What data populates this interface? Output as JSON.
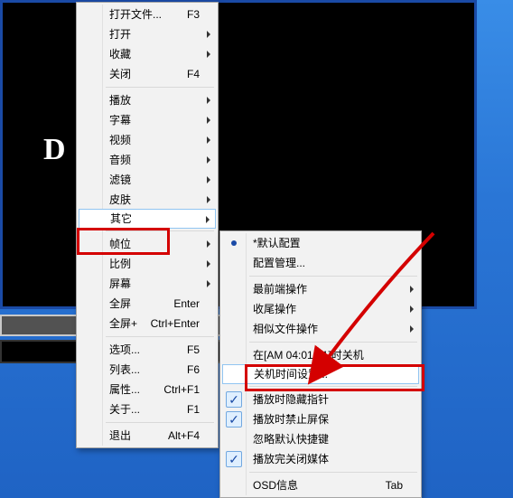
{
  "app_letter": "D",
  "menu1": {
    "openFile": {
      "label": "打开文件...",
      "kb": "F3"
    },
    "open": "打开",
    "fav": "收藏",
    "close": {
      "label": "关闭",
      "kb": "F4"
    },
    "play": "播放",
    "sub": "字幕",
    "video": "视频",
    "audio": "音频",
    "filter": "滤镜",
    "skin": "皮肤",
    "other": "其它",
    "fps": "帧位",
    "ratio": "比例",
    "screen": "屏幕",
    "fullscreen": {
      "label": "全屏",
      "kb": "Enter"
    },
    "fullscreenPlus": {
      "label": "全屏+",
      "kb": "Ctrl+Enter"
    },
    "options": {
      "label": "选项...",
      "kb": "F5"
    },
    "list": {
      "label": "列表...",
      "kb": "F6"
    },
    "props": {
      "label": "属性...",
      "kb": "Ctrl+F1"
    },
    "about": {
      "label": "关于...",
      "kb": "F1"
    },
    "exit": {
      "label": "退出",
      "kb": "Alt+F4"
    }
  },
  "menu2": {
    "defaultCfg": "*默认配置",
    "cfgMgr": "配置管理...",
    "front": "最前端操作",
    "tail": "收尾操作",
    "similar": "相似文件操作",
    "shutdownAt": "在[AM 04:01:01]时关机",
    "shutTime": "关机时间设置...",
    "hidePtr": "播放时隐藏指针",
    "noSaver": "播放时禁止屏保",
    "ignoreHotkey": "忽略默认快捷键",
    "closeMedia": "播放完关闭媒体",
    "osd": {
      "label": "OSD信息",
      "kb": "Tab"
    }
  }
}
